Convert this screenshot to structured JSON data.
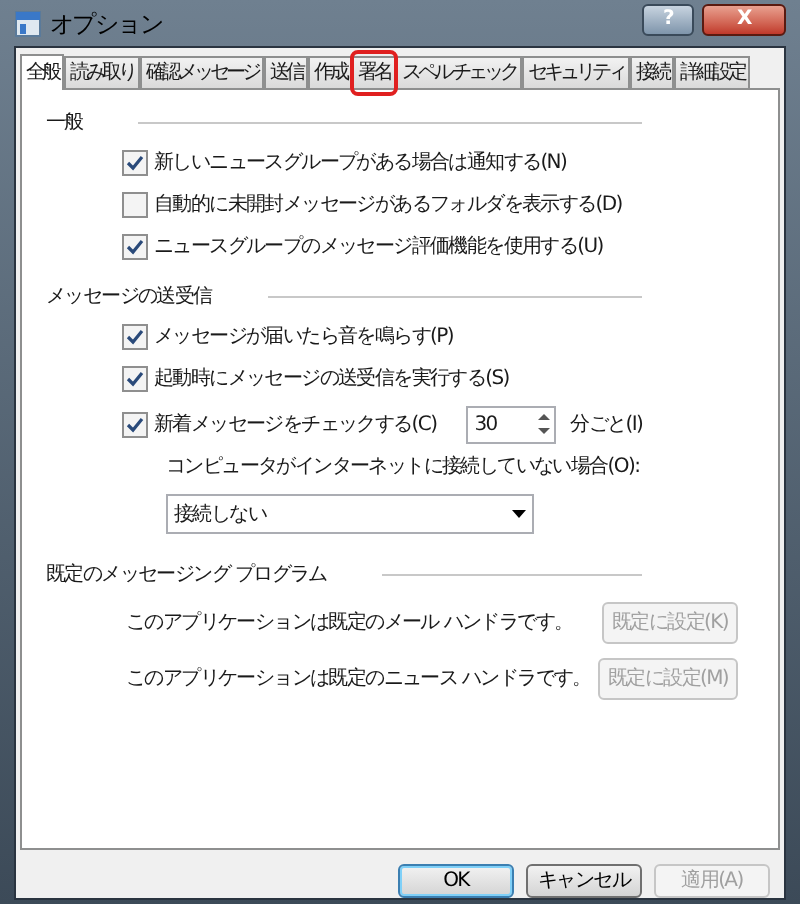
{
  "window": {
    "title": "オプション",
    "help_button": "?",
    "close_button": "X"
  },
  "tabs": [
    {
      "label": "全般",
      "selected": true,
      "annotated": false
    },
    {
      "label": "読み取り",
      "selected": false,
      "annotated": false
    },
    {
      "label": "確認メッセージ",
      "selected": false,
      "annotated": false
    },
    {
      "label": "送信",
      "selected": false,
      "annotated": false
    },
    {
      "label": "作成",
      "selected": false,
      "annotated": false
    },
    {
      "label": "署名",
      "selected": false,
      "annotated": true
    },
    {
      "label": "スペル チェック",
      "selected": false,
      "annotated": false
    },
    {
      "label": "セキュリティ",
      "selected": false,
      "annotated": false
    },
    {
      "label": "接続",
      "selected": false,
      "annotated": false
    },
    {
      "label": "詳細設定",
      "selected": false,
      "annotated": false
    }
  ],
  "sections": [
    {
      "title": "一般",
      "items": [
        {
          "kind": "checkbox",
          "label": "新しいニュースグループがある場合は通知する(N)",
          "checked": true
        },
        {
          "kind": "checkbox",
          "label": "自動的に未開封メッセージがあるフォルダを表示する(D)",
          "checked": false
        },
        {
          "kind": "checkbox",
          "label": "ニュースグループのメッセージ評価機能を使用する(U)",
          "checked": true
        }
      ]
    },
    {
      "title": "メッセージの送受信",
      "items": [
        {
          "kind": "checkbox",
          "label": "メッセージが届いたら音を鳴らす(P)",
          "checked": true
        },
        {
          "kind": "checkbox",
          "label": "起動時にメッセージの送受信を実行する(S)",
          "checked": true
        },
        {
          "kind": "checkbox_spinner",
          "label": "新着メッセージをチェックする(C)",
          "checked": true,
          "value": "30",
          "unit": "分ごと(I)"
        },
        {
          "kind": "dropdown",
          "label": "コンピュータがインターネットに接続していない場合(O):",
          "value": "接続しない"
        }
      ]
    },
    {
      "title": "既定のメッセージング プログラム",
      "items": [
        {
          "kind": "handler",
          "label": "このアプリケーションは既定のメール ハンドラです。",
          "button": "既定に設定(K)",
          "disabled": true
        },
        {
          "kind": "handler",
          "label": "このアプリケーションは既定のニュース ハンドラです。",
          "button": "既定に設定(M)",
          "disabled": true
        }
      ]
    }
  ],
  "buttons": [
    {
      "label": "OK",
      "default": true,
      "disabled": false
    },
    {
      "label": "キャンセル",
      "default": false,
      "disabled": false
    },
    {
      "label": "適用(A)",
      "default": false,
      "disabled": true
    }
  ]
}
